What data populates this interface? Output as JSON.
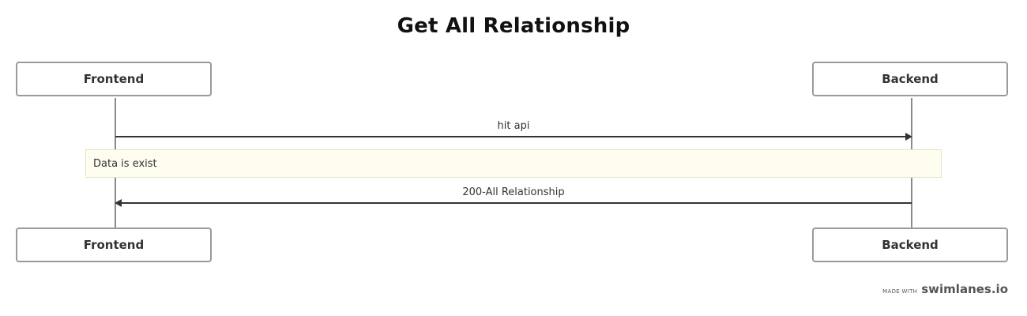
{
  "diagram": {
    "title": "Get All Relationship",
    "participants": [
      {
        "name": "Frontend"
      },
      {
        "name": "Backend"
      }
    ],
    "messages": [
      {
        "from": "Frontend",
        "to": "Backend",
        "label": "hit api"
      },
      {
        "from": "Backend",
        "to": "Frontend",
        "label": "200-All Relationship"
      }
    ],
    "note": {
      "text": "Data is exist"
    }
  },
  "footer": {
    "made_with": "MADE WITH",
    "brand": "swimlanes.io"
  }
}
